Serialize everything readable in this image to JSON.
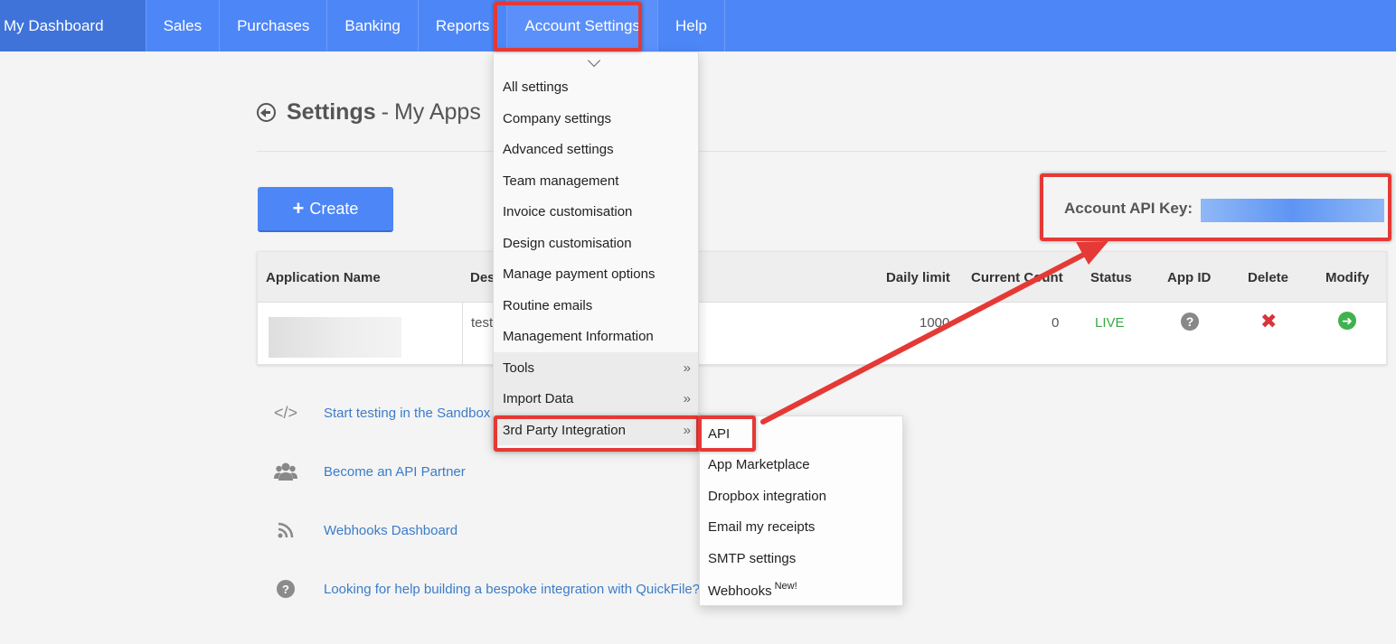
{
  "nav": {
    "brand": "My Dashboard",
    "items": [
      "Sales",
      "Purchases",
      "Banking",
      "Reports",
      "Account Settings",
      "Help"
    ]
  },
  "page": {
    "title": "Settings",
    "separator": "-",
    "subtitle": "My Apps"
  },
  "create_button": {
    "label": "Create"
  },
  "api_key": {
    "label": "Account API Key:"
  },
  "table": {
    "headers": {
      "app_name": "Application Name",
      "description": "Des",
      "daily_limit": "Daily limit",
      "current_count": "Current Count",
      "status": "Status",
      "app_id": "App ID",
      "delete": "Delete",
      "modify": "Modify"
    },
    "row": {
      "description": "test",
      "daily_limit": "1000",
      "current_count": "0",
      "status": "LIVE"
    }
  },
  "links": [
    {
      "icon": "code-icon",
      "text": "Start testing in the Sandbox"
    },
    {
      "icon": "users-icon",
      "text": "Become an API Partner"
    },
    {
      "icon": "rss-icon",
      "text": "Webhooks Dashboard"
    },
    {
      "icon": "question-icon",
      "text": "Looking for help building a bespoke integration with QuickFile?"
    }
  ],
  "menu": {
    "items": [
      "All settings",
      "Company settings",
      "Advanced settings",
      "Team management",
      "Invoice customisation",
      "Design customisation",
      "Manage payment options",
      "Routine emails",
      "Management Information",
      "Tools",
      "Import Data",
      "3rd Party Integration"
    ]
  },
  "submenu": {
    "items": [
      "API",
      "App Marketplace",
      "Dropbox integration",
      "Email my receipts",
      "SMTP settings",
      "Webhooks"
    ],
    "new_badge": "New!"
  },
  "colors": {
    "nav_bg": "#4d86f7",
    "highlight": "#e53935",
    "link": "#3b7cc9",
    "live": "#3aa845",
    "delete": "#d9333a",
    "modify": "#3fb24e"
  }
}
